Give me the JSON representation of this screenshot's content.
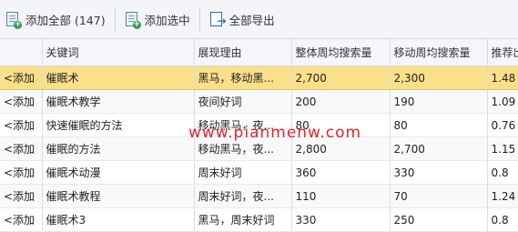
{
  "toolbar": {
    "add_all_label": "添加全部 (147)",
    "add_selected_label": "添加选中",
    "export_all_label": "全部导出"
  },
  "table": {
    "columns": [
      "",
      "关键词",
      "展现理由",
      "整体周均搜索量",
      "移动周均搜索量",
      "推荐出"
    ],
    "rows": [
      {
        "action": "<添加",
        "keyword": "催眠术",
        "reason": "黑马，移动黑...",
        "overall": "2,700",
        "mobile": "2,300",
        "score": "1.48",
        "selected": true
      },
      {
        "action": "<添加",
        "keyword": "催眠术教学",
        "reason": "夜间好词",
        "overall": "200",
        "mobile": "190",
        "score": "1.09"
      },
      {
        "action": "<添加",
        "keyword": "快速催眠的方法",
        "reason": "移动黑马，夜...",
        "overall": "80",
        "mobile": "80",
        "score": "0.76"
      },
      {
        "action": "<添加",
        "keyword": "催眠的方法",
        "reason": "移动黑马，夜...",
        "overall": "2,800",
        "mobile": "2,700",
        "score": "1.15"
      },
      {
        "action": "<添加",
        "keyword": "催眠术动漫",
        "reason": "周末好词",
        "overall": "360",
        "mobile": "330",
        "score": "0.8"
      },
      {
        "action": "<添加",
        "keyword": "催眠术教程",
        "reason": "周末好词，夜...",
        "overall": "110",
        "mobile": "70",
        "score": "1.24"
      },
      {
        "action": "<添加",
        "keyword": "催眠术3",
        "reason": "黑马，周末好词",
        "overall": "330",
        "mobile": "250",
        "score": "0.8"
      }
    ]
  },
  "watermark": "www.pianmenw.com",
  "colors": {
    "selected_row": "#fbe08a",
    "watermark": "#e0242a",
    "toolbar_bg": "#f3f5f8"
  }
}
